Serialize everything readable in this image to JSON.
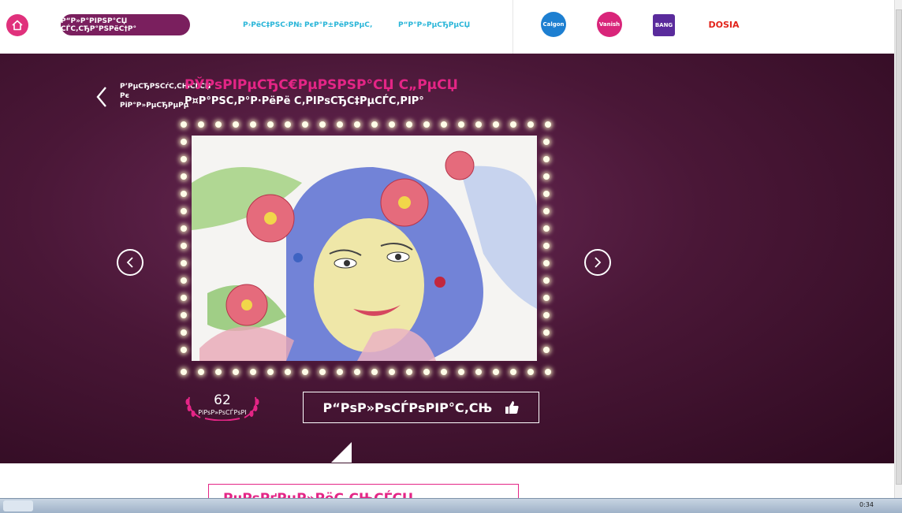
{
  "header": {
    "nav_pill": "Р“Р»Р°РІРЅР°СЏ СЃС‚СЂР°РЅРёС†Р°",
    "link_rules": "Р›РёС‡РЅС‹Р№ РєР°Р±РёРЅРµС‚",
    "link_prizes": "Р“Р°Р»РµСЂРµСЏ"
  },
  "brands": [
    {
      "name": "Calgon",
      "color": "#1d7fd1"
    },
    {
      "name": "Vanish",
      "color": "#d9257a"
    },
    {
      "name": "Cillit Bang",
      "color": "#5a2b9c"
    },
    {
      "name": "DOSIA",
      "color": "#e2231a"
    }
  ],
  "back": {
    "label": "Р’РµСЂРЅСѓС‚СЊСЃСЏ Рє РіР°Р»РµСЂРµРµ"
  },
  "artwork": {
    "title": "РЎРѕРІРµСЂС€РµРЅРЅР°СЏ С„РµСЏ",
    "subtitle": "Р¤Р°РЅС‚Р°Р·РёРё С‚РІРѕСЂС‡РµСЃС‚РІР°"
  },
  "votes": {
    "count": "62",
    "label": "РіРѕР»РѕСЃРѕРІ"
  },
  "vote_button": {
    "label": "Р“РѕР»РѕСЃРѕРІР°С‚СЊ"
  },
  "bottom": {
    "heading": "РџРѕРґРµР»РёС‚СЊСЃСЏ"
  },
  "taskbar": {
    "clock": "0:34"
  },
  "colors": {
    "accent": "#e42586",
    "purple": "#4a1737",
    "nav": "#7a1f5e",
    "link": "#29b5d8"
  }
}
